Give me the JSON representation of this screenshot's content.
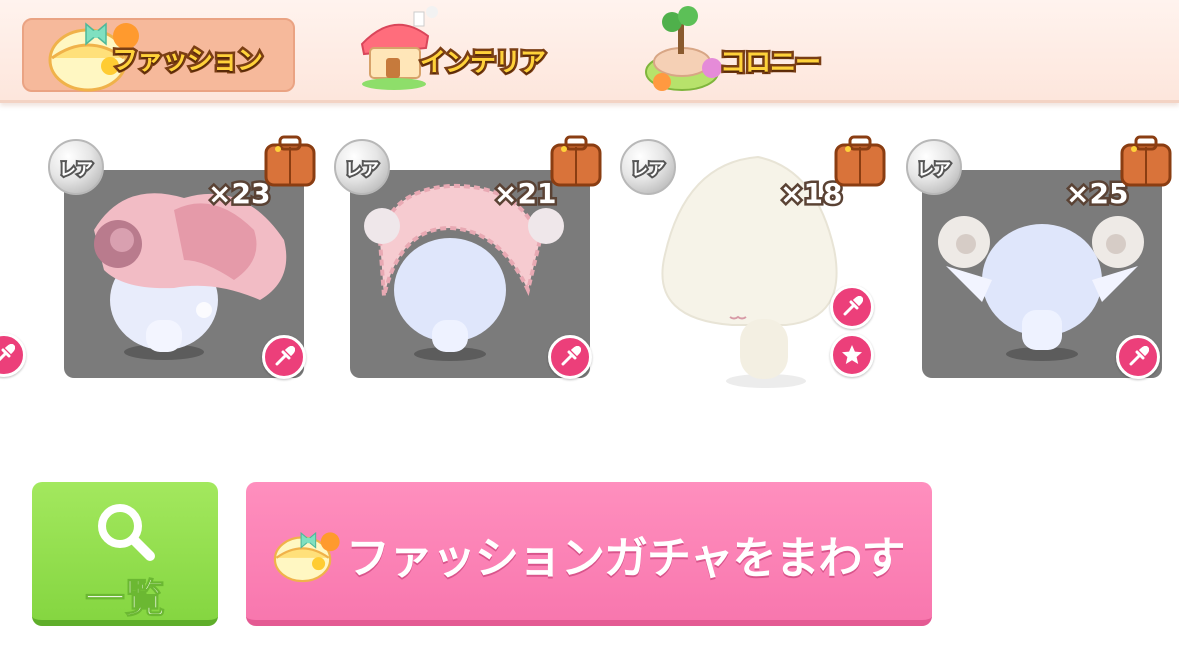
{
  "tabs": [
    {
      "label": "ファッション",
      "active": true,
      "icon": "fashion-gacha-capsule-icon"
    },
    {
      "label": "インテリア",
      "active": false,
      "icon": "interior-house-icon"
    },
    {
      "label": "コロニー",
      "active": false,
      "icon": "colony-island-icon"
    }
  ],
  "items": [
    {
      "rarity": "レア",
      "count": "×23",
      "background": "gray",
      "name": "pink-flower-ruffle-hat"
    },
    {
      "rarity": "レア",
      "count": "×21",
      "background": "gray",
      "name": "pink-ruffle-bonnet"
    },
    {
      "rarity": "レア",
      "count": "×18",
      "background": "white",
      "name": "cream-body"
    },
    {
      "rarity": "レア",
      "count": "×25",
      "background": "gray",
      "name": "white-fluffy-ear-puffs"
    }
  ],
  "buttons": {
    "list_label": "一覧",
    "gacha_label": "ファッションガチャをまわす"
  },
  "colors": {
    "active_tab": "#f6b99b",
    "list_button": "#8fdc4a",
    "gacha_button": "#f982b4",
    "action_circle": "#ec3f7a",
    "card_gray": "#7b7b7b"
  }
}
